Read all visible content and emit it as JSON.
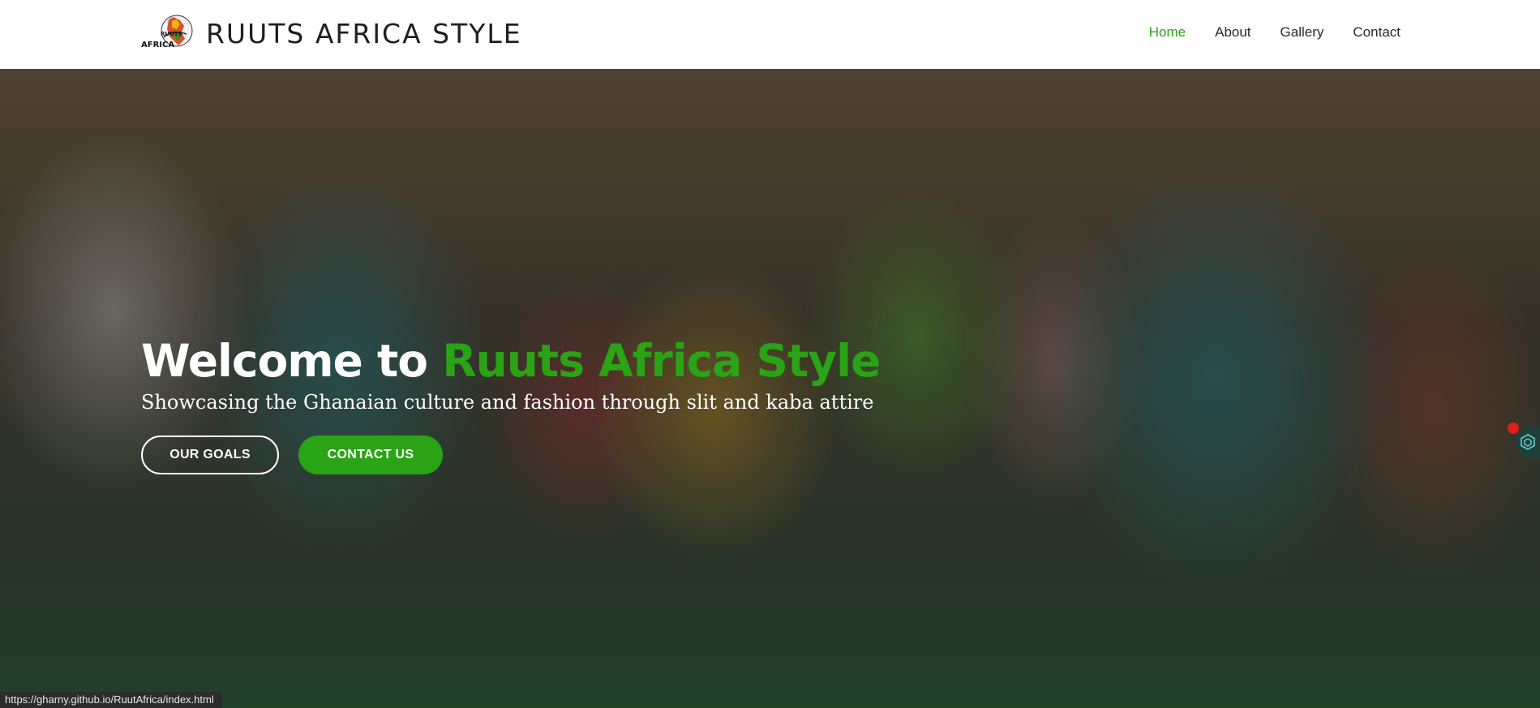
{
  "header": {
    "brand_name": "RUUTS AFRICA STYLE",
    "logo_text_top": "RUUTS",
    "logo_text_bottom": "AFRICA",
    "nav": [
      {
        "label": "Home",
        "active": true
      },
      {
        "label": "About",
        "active": false
      },
      {
        "label": "Gallery",
        "active": false
      },
      {
        "label": "Contact",
        "active": false
      }
    ]
  },
  "hero": {
    "title_prefix": "Welcome to ",
    "title_accent": "Ruuts Africa Style",
    "subtitle": "Showcasing the Ghanaian culture and fashion through slit and kaba attire",
    "buttons": {
      "goals_label": "OUR GOALS",
      "contact_label": "CONTACT US"
    }
  },
  "status_bar": {
    "url": "https://gharny.github.io/RuutAfrica/index.html"
  },
  "colors": {
    "accent": "#2aa316",
    "header_bg": "#ffffff",
    "text_dark": "#1f1f1f",
    "status_bg": "#2b2b2b"
  },
  "icons": {
    "side_widget": "hexagon-icon"
  }
}
